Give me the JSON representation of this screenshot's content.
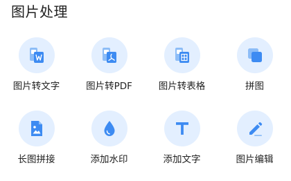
{
  "section": {
    "title": "图片处理"
  },
  "colors": {
    "accent": "#3d8bf2",
    "accent_light": "#8dbdf7",
    "circle_bg": "#e3efff"
  },
  "tools": [
    {
      "label": "图片转文字",
      "icon": "image-to-word-icon"
    },
    {
      "label": "图片转PDF",
      "icon": "image-to-pdf-icon"
    },
    {
      "label": "图片转表格",
      "icon": "image-to-table-icon"
    },
    {
      "label": "拼图",
      "icon": "collage-icon"
    },
    {
      "label": "长图拼接",
      "icon": "long-image-stitch-icon"
    },
    {
      "label": "添加水印",
      "icon": "watermark-drop-icon"
    },
    {
      "label": "添加文字",
      "icon": "text-t-icon"
    },
    {
      "label": "图片编辑",
      "icon": "edit-pencil-icon"
    }
  ]
}
